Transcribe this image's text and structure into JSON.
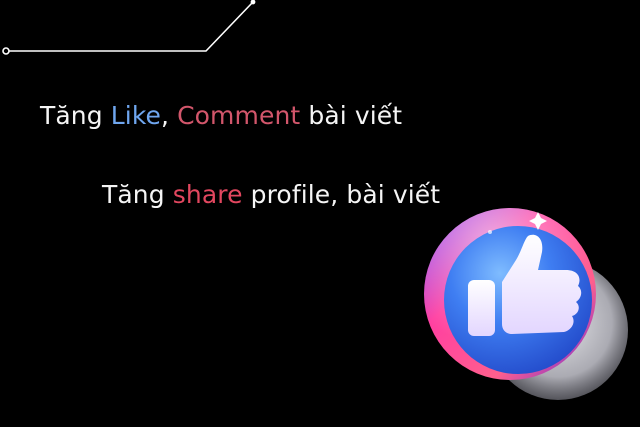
{
  "headline_1": {
    "prefix": "Tăng ",
    "like": "Like",
    "comma": ", ",
    "comment": "Comment",
    "suffix": " bài viết"
  },
  "headline_2": {
    "prefix": "Tăng ",
    "share": "share",
    "suffix": " profile, bài viết"
  },
  "colors": {
    "background": "#000000",
    "text": "#f5f5f5",
    "like": "#6fa6ef",
    "comment": "#d2566b",
    "share": "#e2475f",
    "badge_blue": "#3f7ef2",
    "badge_pink": "#ec4aa0"
  },
  "icons": {
    "badge": "thumbs-up-icon",
    "decoration": "line-decoration"
  }
}
